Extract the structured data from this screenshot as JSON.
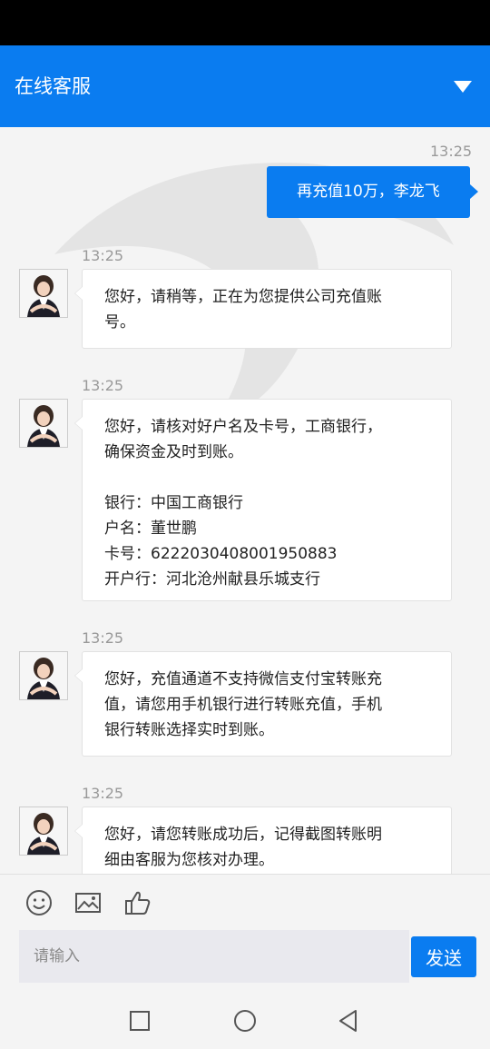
{
  "header": {
    "title": "在线客服",
    "dropdown_icon": "caret-down-icon"
  },
  "messages": {
    "outgoing": {
      "time": "13:25",
      "text": "再充值10万，李龙飞"
    },
    "m1": {
      "time": "13:25",
      "lines": [
        "您好，请稍等，正在为您提供公司充值账",
        "号。"
      ]
    },
    "m2": {
      "time": "13:25",
      "lines": [
        "您好，请核对好户名及卡号，工商银行，",
        "确保资金及时到账。"
      ],
      "bank": "银行：中国工商银行",
      "name": "户名：董世鹏",
      "card": "卡号：6222030408001950883",
      "branch": "开户行：河北沧州献县乐城支行"
    },
    "m3": {
      "time": "13:25",
      "lines": [
        "您好，充值通道不支持微信支付宝转账充",
        "值，请您用手机银行进行转账充值，手机",
        "银行转账选择实时到账。"
      ]
    },
    "m4": {
      "time": "13:25",
      "lines": [
        "您好，请您转账成功后，记得截图转账明",
        "细由客服为您核对办理。"
      ]
    }
  },
  "toolbar": {
    "icons": [
      "emoji-icon",
      "image-icon",
      "thumbs-up-icon"
    ]
  },
  "composer": {
    "placeholder": "请输入",
    "send_label": "发送"
  },
  "colors": {
    "accent": "#0a7cf0",
    "background": "#f4f4f4"
  }
}
